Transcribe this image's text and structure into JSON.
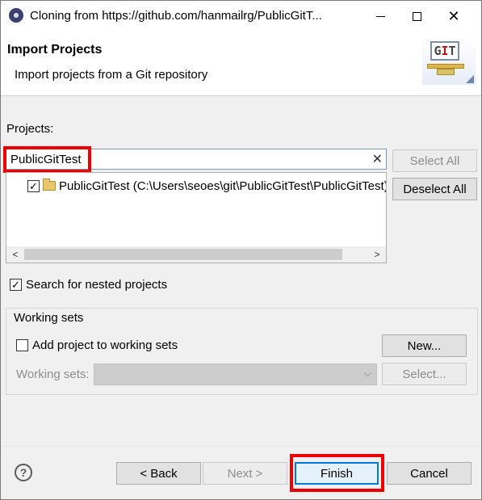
{
  "window": {
    "title": "Cloning from https://github.com/hanmailrg/PublicGitT...",
    "minimize_symbol": "minimize",
    "maximize_symbol": "maximize",
    "close_symbol": "✕"
  },
  "header": {
    "title": "Import Projects",
    "description": "Import projects from a Git repository",
    "logo_letters": [
      "G",
      "I",
      "T"
    ]
  },
  "projects": {
    "label": "Projects:",
    "filter_value": "PublicGitTest",
    "clear_symbol": "✕",
    "tree_items": [
      {
        "checked": true,
        "label": "PublicGitTest (C:\\Users\\seoes\\git\\PublicGitTest\\PublicGitTest)"
      }
    ],
    "scroll_left": "<",
    "scroll_right": ">",
    "select_all_label": "Select All",
    "deselect_all_label": "Deselect All"
  },
  "nested": {
    "checked": true,
    "label": "Search for nested projects"
  },
  "working_sets": {
    "group_title": "Working sets",
    "add_checked": false,
    "add_label": "Add project to working sets",
    "new_button_label": "New...",
    "sets_label": "Working sets:",
    "combo_value": "",
    "select_button_label": "Select..."
  },
  "footer": {
    "help_symbol": "?",
    "back_label": "< Back",
    "next_label": "Next >",
    "finish_label": "Finish",
    "cancel_label": "Cancel"
  },
  "colors": {
    "highlight_red": "#ee0000",
    "focus_blue": "#0078d7",
    "dialog_bg": "#f0f0f0"
  }
}
